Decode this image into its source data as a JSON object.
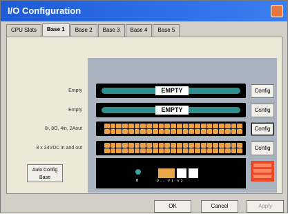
{
  "window": {
    "title": "I/O Configuration"
  },
  "tabs": [
    {
      "label": "CPU Slots"
    },
    {
      "label": "Base 1"
    },
    {
      "label": "Base 2"
    },
    {
      "label": "Base 3"
    },
    {
      "label": "Base 4"
    },
    {
      "label": "Base 5"
    }
  ],
  "slots": [
    {
      "label": "Empty",
      "display": "EMPTY",
      "config": "Config"
    },
    {
      "label": "Empty",
      "display": "EMPTY",
      "config": "Config"
    },
    {
      "label": "8i, 8O, 4in, 2Aout",
      "config": "Config"
    },
    {
      "label": "8 x 24VDC in and out",
      "config": "Config"
    }
  ],
  "psu": {
    "led_label": "B",
    "switch_labels": "P-- Y1 Y2"
  },
  "buttons": {
    "auto_config": "Auto Config Base",
    "ok": "OK",
    "cancel": "Cancel",
    "apply": "Apply"
  }
}
